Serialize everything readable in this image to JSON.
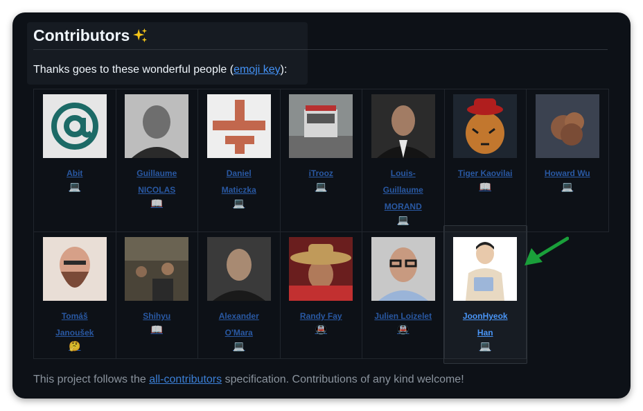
{
  "heading": {
    "title": "Contributors",
    "emoji": "sparkles-icon"
  },
  "intro": {
    "prefix": "Thanks goes to these wonderful people (",
    "link": "emoji key",
    "suffix": "):"
  },
  "contributors": [
    {
      "name_line1": "Abit",
      "name_line2": "",
      "name_line3": "",
      "badge": "💻",
      "avatar": "at-sign-avatar"
    },
    {
      "name_line1": "Guillaume",
      "name_line2": "NICOLAS",
      "name_line3": "",
      "badge": "📖",
      "avatar": "person-avatar"
    },
    {
      "name_line1": "Daniel",
      "name_line2": "Maticzka",
      "name_line3": "",
      "badge": "💻",
      "avatar": "cross-logo-avatar"
    },
    {
      "name_line1": "iTrooz",
      "name_line2": "",
      "name_line3": "",
      "badge": "💻",
      "avatar": "truck-photo-avatar"
    },
    {
      "name_line1": "Louis-",
      "name_line2": "Guillaume",
      "name_line3": "MORAND",
      "badge": "💻",
      "avatar": "person-avatar"
    },
    {
      "name_line1": "Tiger Kaovilai",
      "name_line2": "",
      "name_line3": "",
      "badge": "📖",
      "avatar": "tiger-avatar"
    },
    {
      "name_line1": "Howard Wu",
      "name_line2": "",
      "name_line3": "",
      "badge": "💻",
      "avatar": "smoke-avatar"
    },
    {
      "name_line1": "Tomáš",
      "name_line2": "Janoušek",
      "name_line3": "",
      "badge": "🤔",
      "avatar": "bearded-person-avatar"
    },
    {
      "name_line1": "Shihyu",
      "name_line2": "",
      "name_line3": "",
      "badge": "📖",
      "avatar": "group-photo-avatar"
    },
    {
      "name_line1": "Alexander",
      "name_line2": "O'Mara",
      "name_line3": "",
      "badge": "💻",
      "avatar": "person-avatar"
    },
    {
      "name_line1": "Randy Fay",
      "name_line2": "",
      "name_line3": "",
      "badge": "🚇",
      "avatar": "hat-person-avatar"
    },
    {
      "name_line1": "Julien Loizelet",
      "name_line2": "",
      "name_line3": "",
      "badge": "🚇",
      "avatar": "glasses-person-avatar"
    },
    {
      "name_line1": "JoonHyeok",
      "name_line2": "Han",
      "name_line3": "",
      "badge": "💻",
      "avatar": "person-with-laptop-avatar"
    }
  ],
  "footer": {
    "prefix": "This project follows the ",
    "link": "all-contributors",
    "suffix": " specification. Contributions of any kind welcome!"
  },
  "colors": {
    "background": "#0d1117",
    "link": "#4493f8",
    "text": "#f0f6fc",
    "muted": "#8b949e",
    "arrow": "#1a9f3a"
  }
}
